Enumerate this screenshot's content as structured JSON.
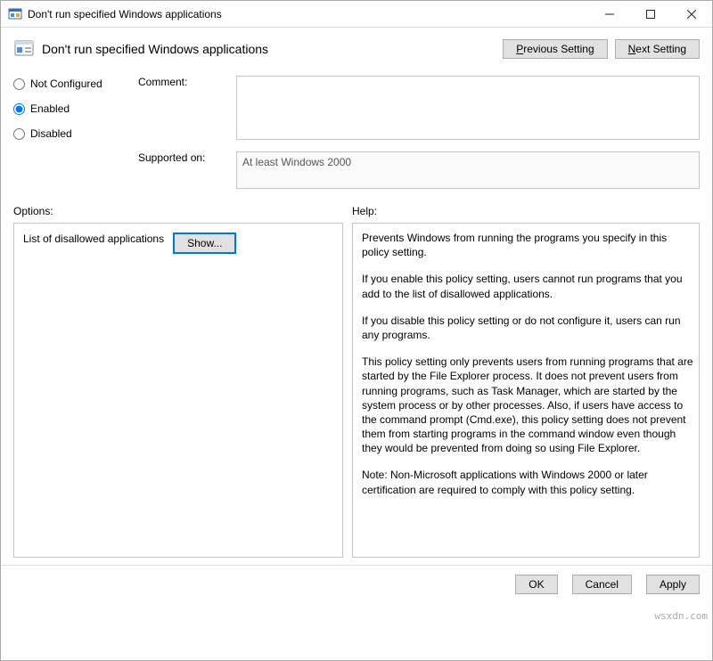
{
  "window": {
    "title": "Don't run specified Windows applications"
  },
  "header": {
    "title": "Don't run specified Windows applications",
    "previous_btn": "Previous Setting",
    "next_btn": "Next Setting"
  },
  "radios": {
    "not_configured": "Not Configured",
    "enabled": "Enabled",
    "disabled": "Disabled",
    "selected": "enabled"
  },
  "labels": {
    "comment": "Comment:",
    "supported_on": "Supported on:",
    "options": "Options:",
    "help": "Help:"
  },
  "supported_on_value": "At least Windows 2000",
  "options_panel": {
    "item_label": "List of disallowed applications",
    "show_btn": "Show..."
  },
  "help_paragraphs": [
    "Prevents Windows from running the programs you specify in this policy setting.",
    "If you enable this policy setting, users cannot run programs that you add to the list of disallowed applications.",
    "If you disable this policy setting or do not configure it, users can run any programs.",
    "This policy setting only prevents users from running programs that are started by the File Explorer process. It does not prevent users from running programs, such as Task Manager, which are started by the system process or by other processes.  Also, if users have access to the command prompt (Cmd.exe), this policy setting does not prevent them from starting programs in the command window even though they would be prevented from doing so using File Explorer.",
    "Note: Non-Microsoft applications with Windows 2000 or later certification are required to comply with this policy setting."
  ],
  "footer": {
    "ok": "OK",
    "cancel": "Cancel",
    "apply": "Apply"
  },
  "watermark": "wsxdn.com"
}
